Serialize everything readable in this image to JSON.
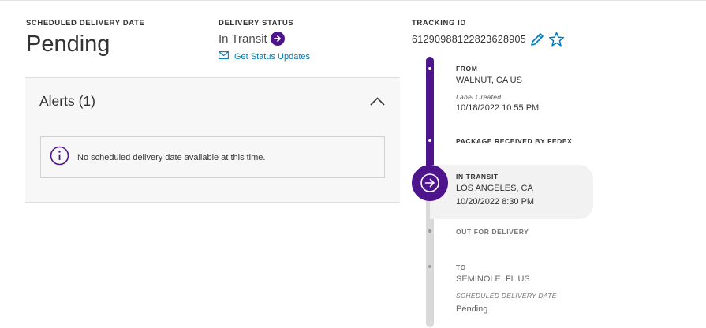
{
  "scheduled": {
    "label": "SCHEDULED DELIVERY DATE",
    "value": "Pending"
  },
  "delivery_status": {
    "label": "DELIVERY STATUS",
    "value": "In Transit",
    "updates_link": "Get Status Updates"
  },
  "tracking": {
    "label": "TRACKING ID",
    "number": "612909881228236289​05"
  },
  "alerts": {
    "title": "Alerts (1)",
    "message": "No scheduled delivery date available at this time."
  },
  "timeline": {
    "from": {
      "heading": "FROM",
      "location": "WALNUT, CA US",
      "event": "Label Created",
      "datetime": "10/18/2022 10:55 PM"
    },
    "received": {
      "heading": "PACKAGE RECEIVED BY FEDEX"
    },
    "in_transit": {
      "heading": "IN TRANSIT",
      "location": "LOS ANGELES, CA",
      "datetime": "10/20/2022 8:30 PM"
    },
    "out_for_delivery": {
      "heading": "OUT FOR DELIVERY"
    },
    "to": {
      "heading": "TO",
      "location": "SEMINOLE, FL US",
      "sub_label": "SCHEDULED DELIVERY DATE",
      "value": "Pending"
    }
  },
  "colors": {
    "brand_purple": "#4d148c",
    "link_blue": "#007ab7",
    "rail_gray": "#d9d9d9"
  },
  "icons": {
    "status": "arrow-right-circle-icon",
    "updates": "envelope-icon",
    "edit": "pencil-icon",
    "favorite": "star-icon",
    "collapse": "chevron-up-icon",
    "alert": "info-circle-icon",
    "current_step": "arrow-right-circle-icon"
  }
}
